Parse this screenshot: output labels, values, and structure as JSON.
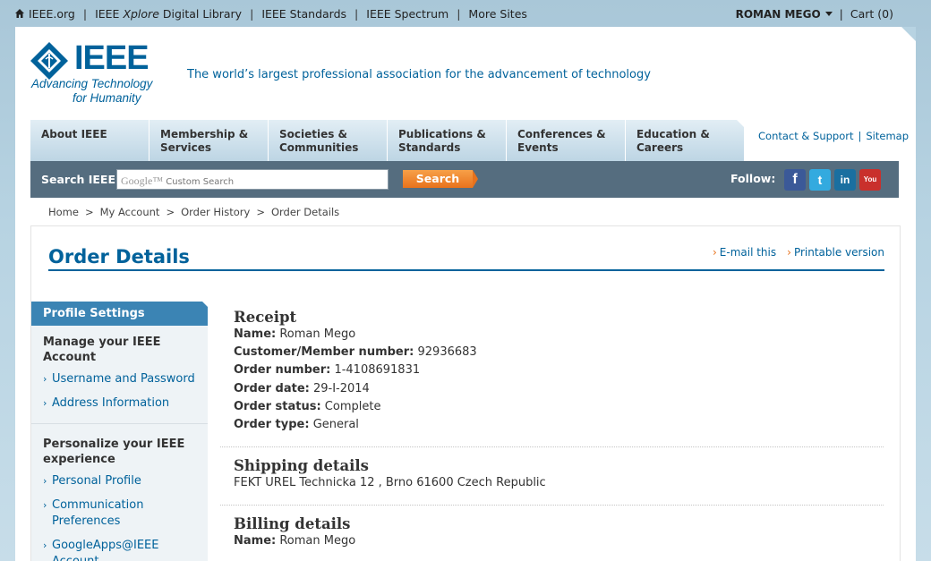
{
  "topbar": {
    "links": [
      "IEEE.org",
      "IEEE Xplore Digital Library",
      "IEEE Standards",
      "IEEE Spectrum",
      "More Sites"
    ],
    "user": "ROMAN MEGO",
    "cart": "Cart (0)"
  },
  "header": {
    "logo_text": "IEEE",
    "logo_tag_line1": "Advancing Technology",
    "logo_tag_line2": "for Humanity",
    "tagline": "The world’s largest professional association for the advancement of technology"
  },
  "nav": {
    "tabs": [
      {
        "line1": "About IEEE",
        "line2": ""
      },
      {
        "line1": "Membership &",
        "line2": "Services"
      },
      {
        "line1": "Societies &",
        "line2": "Communities"
      },
      {
        "line1": "Publications &",
        "line2": "Standards"
      },
      {
        "line1": "Conferences &",
        "line2": "Events"
      },
      {
        "line1": "Education &",
        "line2": "Careers"
      }
    ],
    "contact": "Contact & Support",
    "sitemap": "Sitemap"
  },
  "search": {
    "label": "Search IEEE",
    "google": "Google™",
    "placeholder": "Custom Search",
    "button": "Search",
    "follow": "Follow:",
    "social": [
      {
        "icon": "facebook-icon",
        "glyph": "f"
      },
      {
        "icon": "twitter-icon",
        "glyph": "t"
      },
      {
        "icon": "linkedin-icon",
        "glyph": "in"
      },
      {
        "icon": "youtube-icon",
        "glyph": "You Tube"
      }
    ]
  },
  "breadcrumb": [
    "Home",
    "My Account",
    "Order History",
    "Order Details"
  ],
  "page": {
    "title": "Order Details",
    "email": "E-mail this",
    "printable": "Printable version"
  },
  "sidebar": {
    "heading": "Profile Settings",
    "sections": [
      {
        "title": "Manage your IEEE Account",
        "items": [
          "Username and Password",
          "Address Information"
        ]
      },
      {
        "title": "Personalize your IEEE experience",
        "items": [
          "Personal Profile",
          "Communication Preferences",
          "GoogleApps@IEEE Account"
        ]
      }
    ]
  },
  "receipt": {
    "heading": "Receipt",
    "rows": [
      {
        "label": "Name:",
        "value": "Roman Mego"
      },
      {
        "label": "Customer/Member number:",
        "value": "92936683"
      },
      {
        "label": "Order number:",
        "value": "1-4108691831"
      },
      {
        "label": "Order date:",
        "value": "29-I-2014"
      },
      {
        "label": "Order status:",
        "value": "Complete"
      },
      {
        "label": "Order type:",
        "value": "General"
      }
    ]
  },
  "shipping": {
    "heading": "Shipping details",
    "address": "FEKT UREL Technicka 12 , Brno 61600 Czech Republic"
  },
  "billing": {
    "heading": "Billing details",
    "rows": [
      {
        "label": "Name:",
        "value": "Roman Mego"
      }
    ]
  },
  "colors": {
    "ieee_blue": "#00629b",
    "search_bar": "#556d7f",
    "search_button": "#e8721c",
    "sidebar_head": "#3b84b4"
  }
}
